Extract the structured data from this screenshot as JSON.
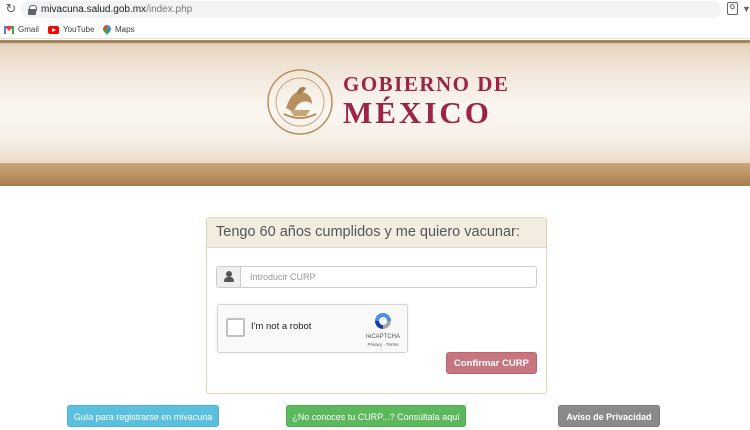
{
  "browser": {
    "url_host": "mivacuna.salud.gob.mx",
    "url_path": "/index.php",
    "bookmarks": [
      {
        "label": "Gmail",
        "icon": "gmail-icon"
      },
      {
        "label": "YouTube",
        "icon": "youtube-icon"
      },
      {
        "label": "Maps",
        "icon": "maps-icon"
      }
    ]
  },
  "header": {
    "brand_line1": "GOBIERNO DE",
    "brand_line2": "MÉXICO",
    "seal_icon": "coat-of-arms-seal",
    "brand_color": "#9c2446"
  },
  "form": {
    "title": "Tengo 60 años cumplidos y me quiero vacunar:",
    "curp_placeholder": "Introducir CURP",
    "curp_value": "",
    "captcha_label": "I'm not a robot",
    "captcha_checked": false,
    "captcha_brand": "reCAPTCHA",
    "captcha_terms": "Privacy - Terms",
    "confirm_label": "Confirmar CURP"
  },
  "footer_buttons": {
    "guide_label": "Guía para registrarse en mivacuna",
    "curp_label": "¿No conoces tu CURP...? Consúltala aquí",
    "privacy_label": "Aviso de Privacidad"
  },
  "colors": {
    "guide_button": "#5bc0de",
    "curp_button": "#5cb85c",
    "privacy_button": "#8a8a8a",
    "confirm_button": "#c7757f"
  }
}
